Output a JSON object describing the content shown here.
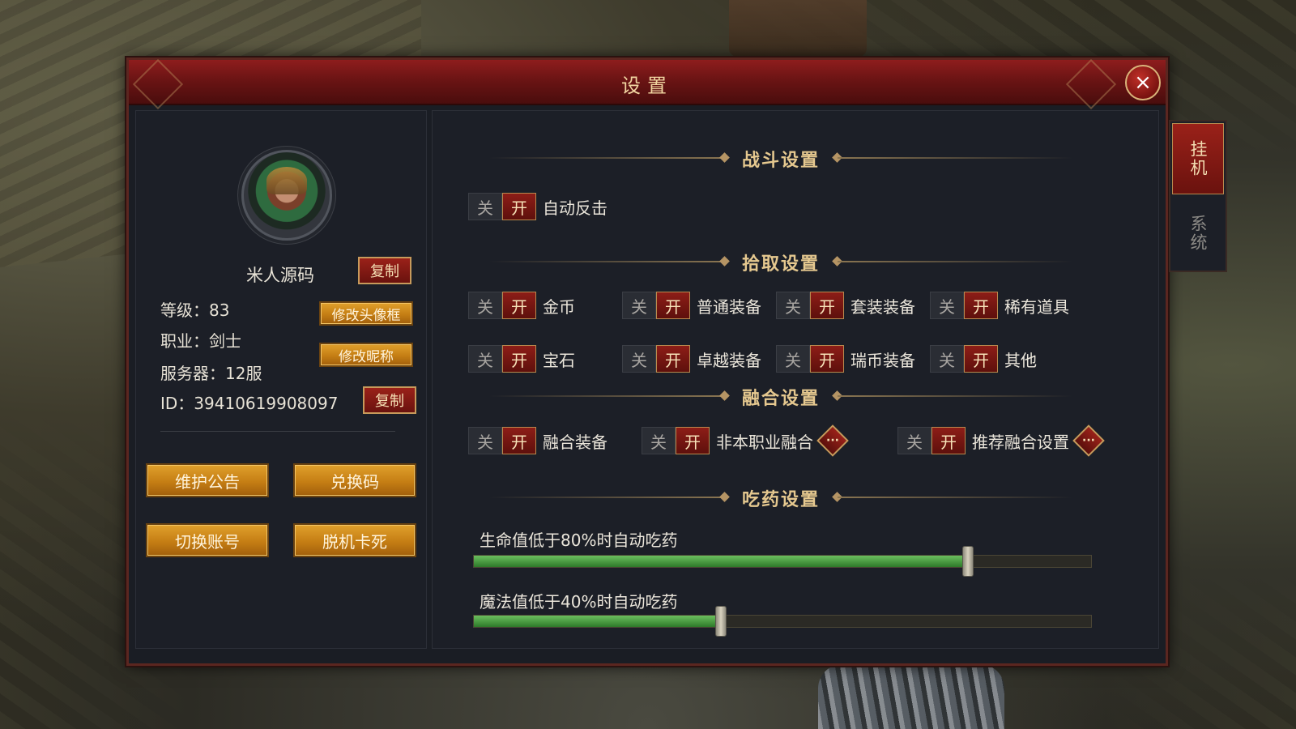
{
  "dialog": {
    "title": "设置",
    "close_icon": "×"
  },
  "profile": {
    "name": "米人源码",
    "copy_name_label": "复制",
    "level_text": "等级：83",
    "class_text": "职业：剑士",
    "server_text": "服务器：12服",
    "id_text": "ID：39410619908097",
    "copy_id_label": "复制",
    "edit_avatar_frame_label": "修改头像框",
    "edit_nickname_label": "修改昵称"
  },
  "actions": {
    "maintenance_label": "维护公告",
    "redeem_label": "兑换码",
    "switch_account_label": "切换账号",
    "unstuck_label": "脱机卡死"
  },
  "toggle_text": {
    "off": "关",
    "on": "开"
  },
  "combat": {
    "title": "战斗设置",
    "items": [
      {
        "label": "自动反击",
        "state": "on"
      }
    ]
  },
  "pickup": {
    "title": "拾取设置",
    "items": [
      {
        "label": "金币",
        "state": "on"
      },
      {
        "label": "普通装备",
        "state": "on"
      },
      {
        "label": "套装装备",
        "state": "on"
      },
      {
        "label": "稀有道具",
        "state": "on"
      },
      {
        "label": "宝石",
        "state": "on"
      },
      {
        "label": "卓越装备",
        "state": "on"
      },
      {
        "label": "瑞币装备",
        "state": "on"
      },
      {
        "label": "其他",
        "state": "on"
      }
    ]
  },
  "fusion": {
    "title": "融合设置",
    "items": [
      {
        "label": "融合装备",
        "state": "on"
      },
      {
        "label": "非本职业融合",
        "state": "on"
      },
      {
        "label": "推荐融合设置",
        "state": "on"
      }
    ],
    "more_icon": "···"
  },
  "potion": {
    "title": "吃药设置",
    "hp_label": "生命值低于80%时自动吃药",
    "hp_threshold_pct": 80,
    "mp_label": "魔法值低于40%时自动吃药",
    "mp_threshold_pct": 40
  },
  "side_tabs": [
    {
      "label": "挂机",
      "active": true
    },
    {
      "label": "系统",
      "active": false
    }
  ],
  "colors": {
    "accent_red": "#8d1d17",
    "gold_button": "#c57e14",
    "section_title": "#e5c88f",
    "slider_fill": "#3f9a38"
  }
}
